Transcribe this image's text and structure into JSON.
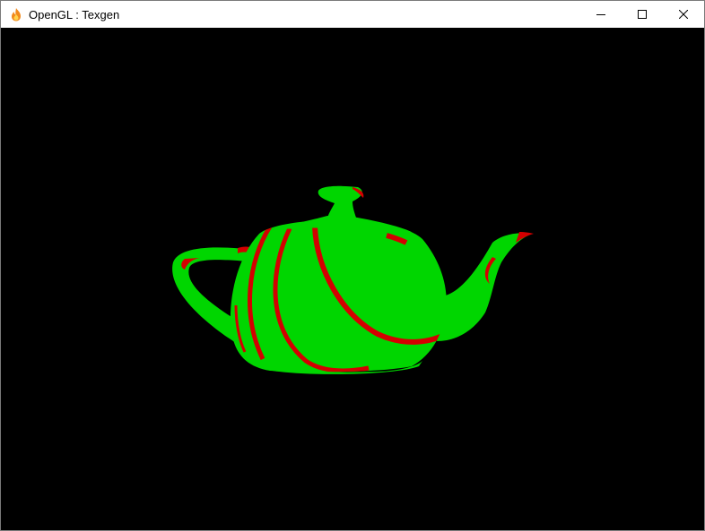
{
  "window": {
    "title": "OpenGL : Texgen",
    "app_icon": "flame-icon",
    "controls": [
      "minimize-icon",
      "maximize-icon",
      "close-icon"
    ]
  },
  "scene": {
    "object": "teapot",
    "background_color": "#000000",
    "base_color": "#00d600",
    "stripe_color": "#d40000"
  }
}
